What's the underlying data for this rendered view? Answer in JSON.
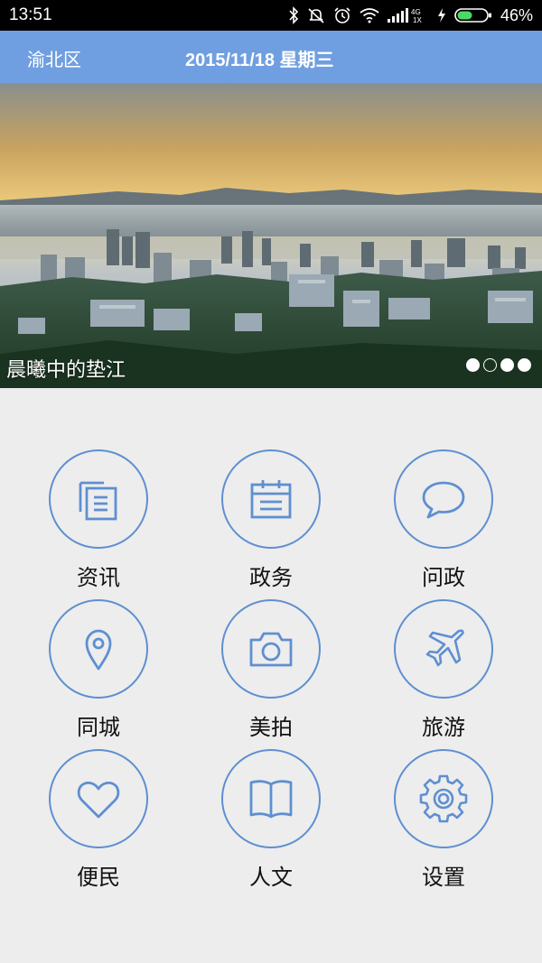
{
  "status_bar": {
    "time": "13:51",
    "network": "4G",
    "network_sub": "1X",
    "battery": "46%",
    "icons": [
      "bluetooth-icon",
      "mute-icon",
      "alarm-icon",
      "wifi-icon",
      "signal-icon",
      "charging-icon",
      "battery-icon"
    ]
  },
  "header": {
    "region": "渝北区",
    "date": "2015/11/18 星期三"
  },
  "banner": {
    "caption": "晨曦中的垫江",
    "page_count": 4
  },
  "grid": {
    "items": [
      {
        "label": "资讯",
        "icon": "news-icon"
      },
      {
        "label": "政务",
        "icon": "calendar-icon"
      },
      {
        "label": "问政",
        "icon": "chat-bubble-icon"
      },
      {
        "label": "同城",
        "icon": "location-pin-icon"
      },
      {
        "label": "美拍",
        "icon": "camera-icon"
      },
      {
        "label": "旅游",
        "icon": "airplane-icon"
      },
      {
        "label": "便民",
        "icon": "heart-icon"
      },
      {
        "label": "人文",
        "icon": "book-icon"
      },
      {
        "label": "设置",
        "icon": "gear-icon"
      }
    ]
  },
  "colors": {
    "header": "#6f9fe0",
    "icon_stroke": "#5e8fd1",
    "background": "#ededed"
  }
}
